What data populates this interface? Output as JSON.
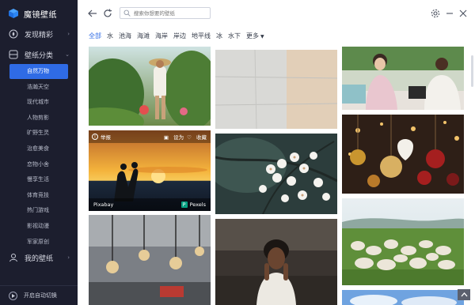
{
  "app": {
    "name": "魔镜壁纸"
  },
  "sidebar": {
    "discover": "发现精彩",
    "category": "壁纸分类",
    "my_wallpaper": "我的壁纸",
    "items": [
      "自然万物",
      "浩瀚天空",
      "现代城市",
      "人物剪影",
      "旷野生灵",
      "治愈美食",
      "恋物小舍",
      "慢享生活",
      "体育竞技",
      "热门游戏",
      "影视动漫",
      "军家原创"
    ],
    "auto_switch": "开启自动切换"
  },
  "search": {
    "placeholder": "搜索你想要的壁纸"
  },
  "tabs": [
    "全部",
    "水",
    "池海",
    "海滩",
    "海岸",
    "岸边",
    "地平线",
    "冰",
    "水下",
    "更多"
  ],
  "card_overlay": {
    "report": "举报",
    "set_label": "设为",
    "favorite": "收藏",
    "source_left": "Pixabay",
    "source_right": "Pexels"
  },
  "colors": {
    "accent": "#2f6be5",
    "sidebar_bg": "#1c1e2e"
  }
}
